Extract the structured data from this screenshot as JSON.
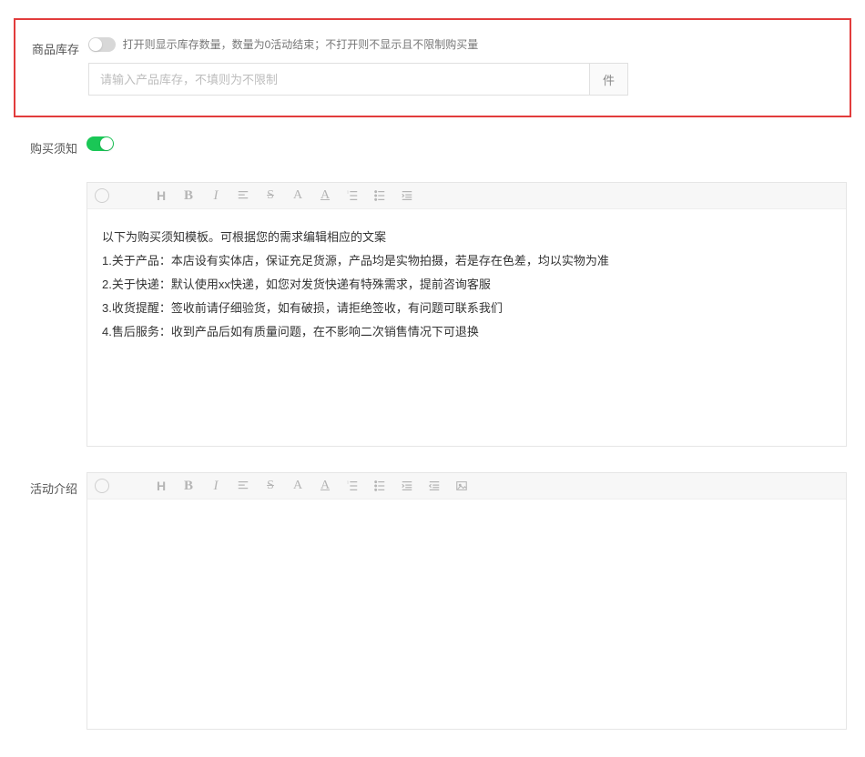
{
  "stock": {
    "label": "商品库存",
    "switch_on": false,
    "desc": "打开则显示库存数量，数量为0活动结束；不打开则不显示且不限制购买量",
    "placeholder": "请输入产品库存，不填则为不限制",
    "addon": "件"
  },
  "notice": {
    "label": "购买须知",
    "switch_on": true,
    "content_intro": "以下为购买须知模板。可根据您的需求编辑相应的文案",
    "lines": [
      "1.关于产品：本店设有实体店，保证充足货源，产品均是实物拍摄，若是存在色差，均以实物为准",
      "2.关于快递：默认使用xx快递，如您对发货快递有特殊需求，提前咨询客服",
      "3.收货提醒：签收前请仔细验货，如有破损，请拒绝签收，有问题可联系我们",
      "4.售后服务：收到产品后如有质量问题，在不影响二次销售情况下可退换"
    ]
  },
  "activity": {
    "label": "活动介绍"
  },
  "toolbar": {
    "heading": "H",
    "bold": "B",
    "italic": "I",
    "strike": "S",
    "size": "A",
    "color": "A"
  }
}
